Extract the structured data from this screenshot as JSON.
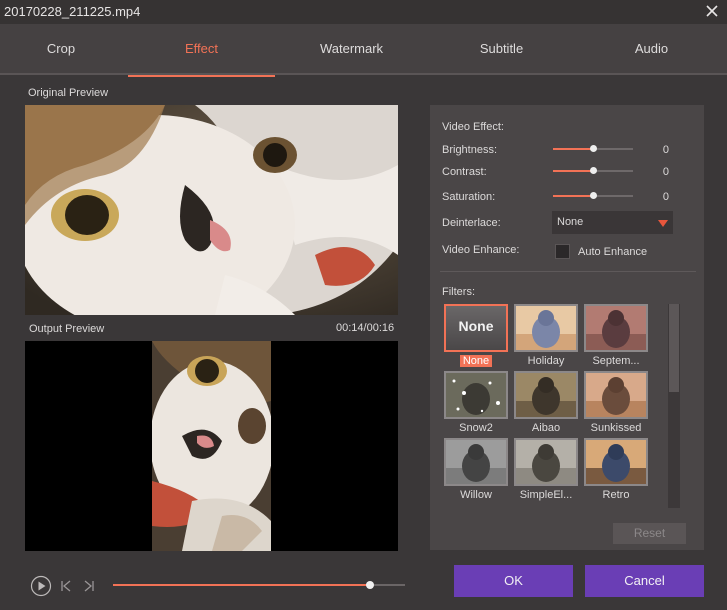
{
  "window": {
    "title": "20170228_211225.mp4"
  },
  "tabs": [
    {
      "label": "Crop",
      "active": false
    },
    {
      "label": "Effect",
      "active": true
    },
    {
      "label": "Watermark",
      "active": false
    },
    {
      "label": "Subtitle",
      "active": false
    },
    {
      "label": "Audio",
      "active": false
    }
  ],
  "preview": {
    "original_label": "Original Preview",
    "output_label": "Output Preview",
    "time": "00:14/00:16",
    "playback_progress": 0.88
  },
  "video_effect": {
    "heading": "Video Effect:",
    "brightness": {
      "label": "Brightness:",
      "value": "0",
      "level": 0.5
    },
    "contrast": {
      "label": "Contrast:",
      "value": "0",
      "level": 0.5
    },
    "saturation": {
      "label": "Saturation:",
      "value": "0",
      "level": 0.5
    },
    "deinterlace": {
      "label": "Deinterlace:",
      "value": "None"
    },
    "enhance": {
      "label": "Video Enhance:",
      "checkbox_label": "Auto Enhance",
      "checked": false
    }
  },
  "filters": {
    "heading": "Filters:",
    "none_thumb_text": "None",
    "items": [
      {
        "name": "None",
        "selected": true
      },
      {
        "name": "Holiday",
        "selected": false
      },
      {
        "name": "Septem...",
        "selected": false
      },
      {
        "name": "Snow2",
        "selected": false
      },
      {
        "name": "Aibao",
        "selected": false
      },
      {
        "name": "Sunkissed",
        "selected": false
      },
      {
        "name": "Willow",
        "selected": false
      },
      {
        "name": "SimpleEl...",
        "selected": false
      },
      {
        "name": "Retro",
        "selected": false
      }
    ],
    "reset_label": "Reset"
  },
  "buttons": {
    "ok": "OK",
    "cancel": "Cancel"
  },
  "colors": {
    "accent": "#f27256",
    "button": "#6a3eb5",
    "background": "#3a3738",
    "panel": "#4a4647"
  },
  "icons": [
    "close-icon",
    "play-icon",
    "previous-frame-icon",
    "next-frame-icon",
    "dropdown-arrow-icon"
  ]
}
